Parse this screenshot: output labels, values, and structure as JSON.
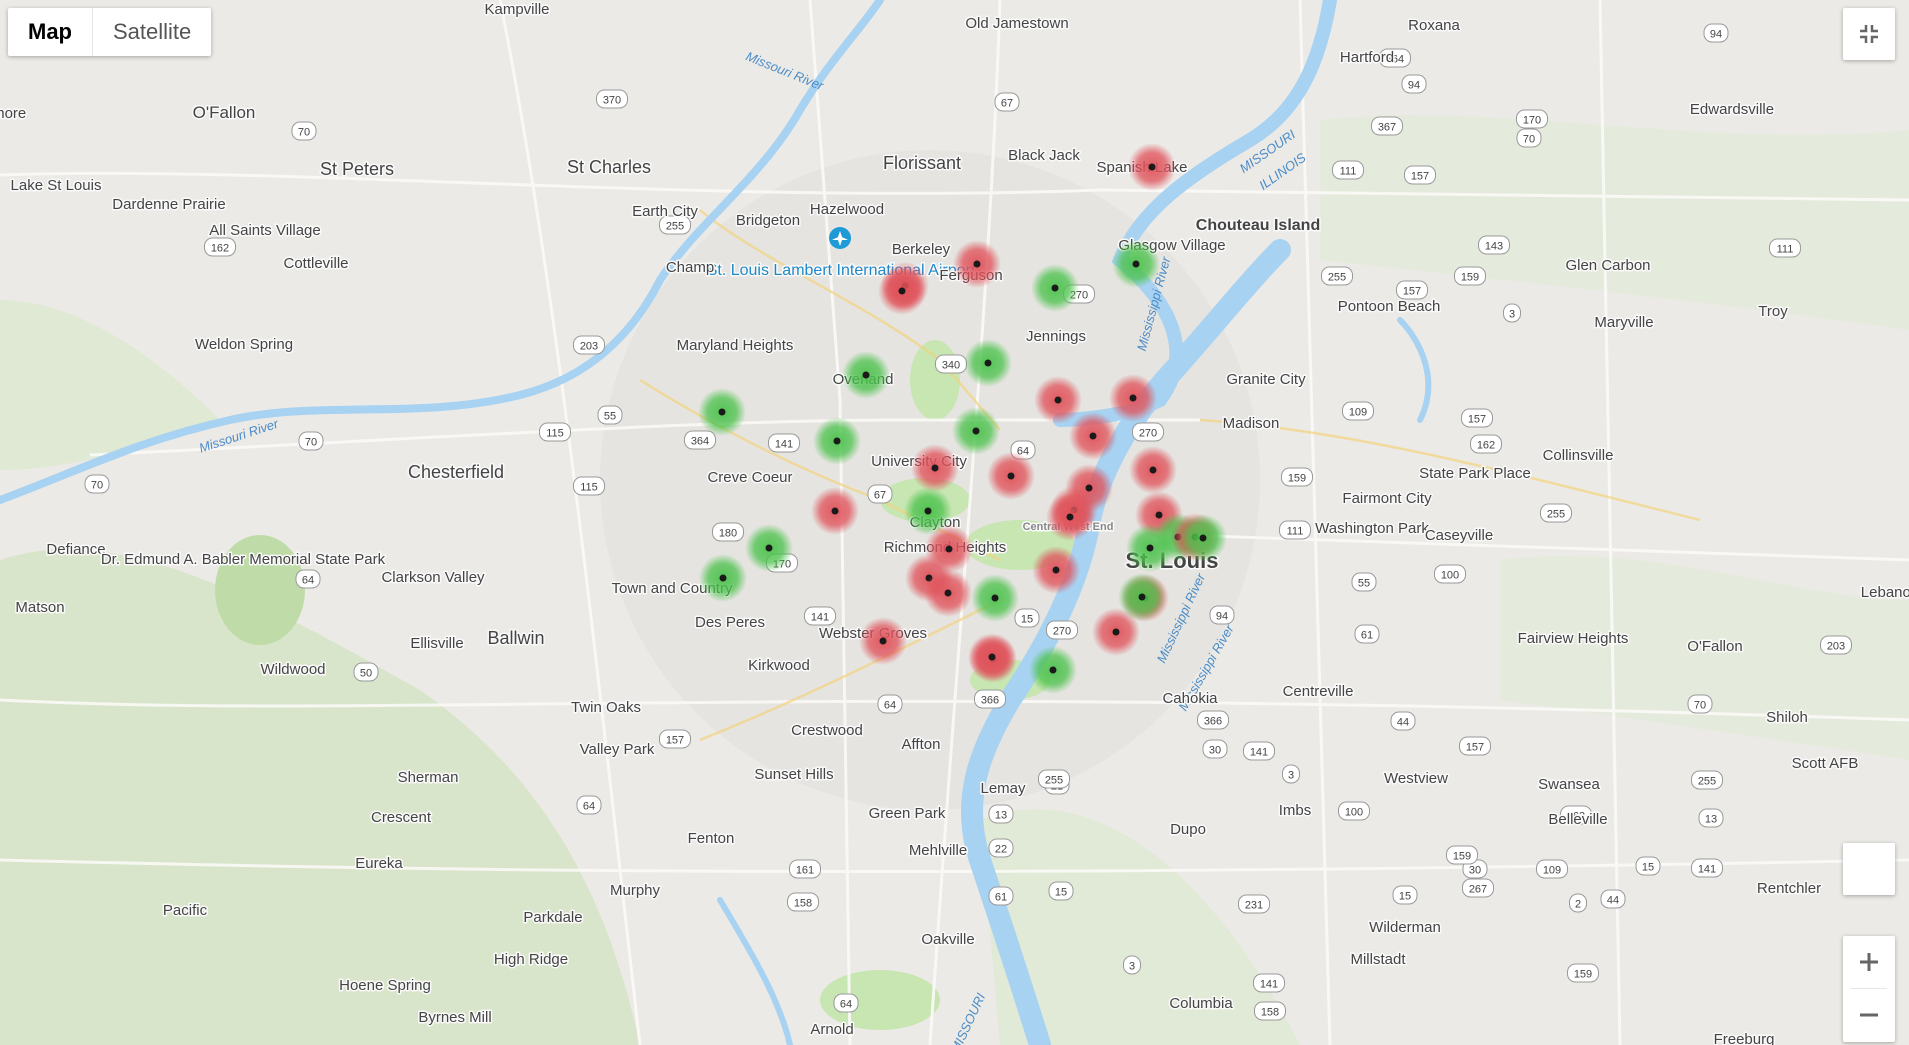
{
  "map_type": {
    "map_label": "Map",
    "satellite_label": "Satellite",
    "selected": "Map"
  },
  "controls": {
    "zoom_in_icon": "plus-icon",
    "zoom_out_icon": "minus-icon",
    "fullscreen_icon": "exit-fullscreen-icon",
    "pegman_icon": "street-view-icon"
  },
  "colors": {
    "marker_red": "#e0525a",
    "marker_green": "#4cc24c",
    "water": "#a7d2f2",
    "park": "#c7e6b2"
  },
  "places": [
    "Kampville",
    "Old Jamestown",
    "Roxana",
    "Hartford",
    "Gilmore",
    "O'Fallon",
    "St Peters",
    "St Charles",
    "Florissant",
    "Black Jack",
    "Spanish Lake",
    "Edwardsville",
    "Lake St Louis",
    "Dardenne Prairie",
    "All Saints Village",
    "Cottleville",
    "Earth City",
    "Hazelwood",
    "Bridgeton",
    "St. Louis Lambert International Airport",
    "Champ",
    "Berkeley",
    "Ferguson",
    "Glasgow Village",
    "Chouteau Island",
    "Glen Carbon",
    "Pontoon Beach",
    "Maryville",
    "Troy",
    "Weldon Spring",
    "Maryland Heights",
    "Jennings",
    "Granite City",
    "Overland",
    "Madison",
    "Chesterfield",
    "Creve Coeur",
    "University City",
    "Collinsville",
    "State Park Place",
    "Fairmont City",
    "Washington Park",
    "Caseyville",
    "Defiance",
    "Clayton",
    "Central West End",
    "St. Louis",
    "Richmond Heights",
    "Dr. Edmund A. Babler Memorial State Park",
    "Clarkson Valley",
    "Matson",
    "Town and Country",
    "Ellisville",
    "Ballwin",
    "Des Peres",
    "Fairview Heights",
    "O'Fallon",
    "Webster Groves",
    "Wildwood",
    "Kirkwood",
    "Centreville",
    "Twin Oaks",
    "Cahokia",
    "Crestwood",
    "Valley Park",
    "Affton",
    "Shiloh",
    "Sherman",
    "Sunset Hills",
    "Westview",
    "Swansea",
    "Scott AFB",
    "Crescent",
    "Lemay",
    "Imbs",
    "Belleville",
    "Green Park",
    "Fenton",
    "Dupo",
    "Mehlville",
    "Eureka",
    "Murphy",
    "Rentchler",
    "Pacific",
    "Parkdale",
    "Wilderman",
    "High Ridge",
    "Millstadt",
    "Hoene Spring",
    "Oakville",
    "Byrnes Mill",
    "Columbia",
    "Arnold",
    "Freeburg",
    "Lebanon"
  ],
  "rivers": [
    "Missouri River",
    "Missouri River",
    "MISSOURI",
    "ILLINOIS",
    "Mississippi River",
    "Mississippi River",
    "Mississippi River",
    "MISSOURI"
  ],
  "road_shields": [
    "370",
    "67",
    "70",
    "94",
    "364",
    "94",
    "70",
    "170",
    "367",
    "111",
    "157",
    "143",
    "159",
    "255",
    "157",
    "3",
    "111",
    "270",
    "255",
    "203",
    "162",
    "55",
    "115",
    "70",
    "364",
    "141",
    "340",
    "64",
    "270",
    "67",
    "115",
    "180",
    "70",
    "170",
    "141",
    "64",
    "94",
    "61",
    "100",
    "109",
    "157",
    "162",
    "159",
    "255",
    "111",
    "55",
    "203",
    "70",
    "64",
    "15",
    "157",
    "64",
    "50",
    "64",
    "366",
    "44",
    "30",
    "141",
    "100",
    "366",
    "270",
    "3",
    "157",
    "255",
    "163",
    "13",
    "15",
    "141",
    "109",
    "267",
    "30",
    "2",
    "44",
    "161",
    "21",
    "255",
    "22",
    "158",
    "15",
    "13",
    "61",
    "141",
    "231",
    "3",
    "158",
    "15",
    "159",
    "159"
  ],
  "markers": [
    {
      "status": "high"
    },
    {
      "status": "high"
    },
    {
      "status": "low"
    },
    {
      "status": "low"
    },
    {
      "status": "high"
    },
    {
      "status": "high"
    },
    {
      "status": "low"
    },
    {
      "status": "low"
    },
    {
      "status": "high"
    },
    {
      "status": "high"
    },
    {
      "status": "low"
    },
    {
      "status": "high"
    },
    {
      "status": "low"
    },
    {
      "status": "high"
    },
    {
      "status": "high"
    },
    {
      "status": "high"
    },
    {
      "status": "high"
    },
    {
      "status": "high"
    },
    {
      "status": "high"
    },
    {
      "status": "high"
    },
    {
      "status": "low"
    },
    {
      "status": "low"
    },
    {
      "status": "high"
    },
    {
      "status": "high"
    },
    {
      "status": "low"
    },
    {
      "status": "low"
    },
    {
      "status": "high"
    },
    {
      "status": "low"
    },
    {
      "status": "high"
    },
    {
      "status": "high"
    },
    {
      "status": "high"
    },
    {
      "status": "low"
    },
    {
      "status": "high"
    },
    {
      "status": "high"
    },
    {
      "status": "low"
    },
    {
      "status": "low"
    },
    {
      "status": "low"
    },
    {
      "status": "high"
    },
    {
      "status": "low"
    },
    {
      "status": "high"
    },
    {
      "status": "high"
    }
  ]
}
